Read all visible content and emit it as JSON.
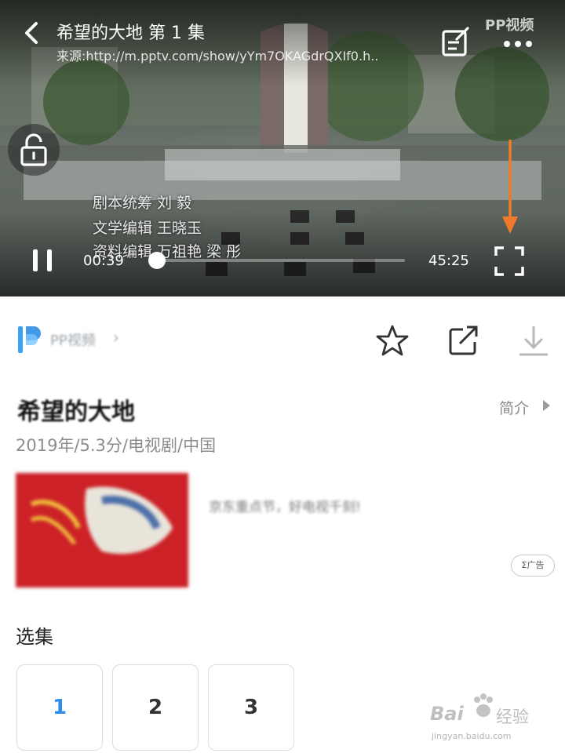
{
  "player": {
    "title": "希望的大地  第 1 集",
    "source": "来源:http://m.pptv.com/show/yYm7OKAGdrQXIf0.h..",
    "watermark": "PP视频",
    "current_time": "00:39",
    "total_time": "45:25",
    "progress": 0.014,
    "subtitle_lines": [
      "剧本统筹  刘  毅",
      "文学编辑  王晓玉",
      "资料编辑  万祖艳  梁  彤"
    ],
    "arrow_color": "#f07a2a"
  },
  "brand": {
    "name": "PP视频"
  },
  "show": {
    "title": "希望的大地",
    "intro_label": "简介",
    "meta": "2019年/5.3分/电视剧/中国"
  },
  "ad": {
    "text": "京东重点节，好电视千刻!",
    "badge": "Σ广告"
  },
  "episodes": {
    "title": "选集",
    "items": [
      {
        "label": "1",
        "active": true
      },
      {
        "label": "2",
        "active": false
      },
      {
        "label": "3",
        "active": false
      }
    ]
  },
  "watermark_overlay": {
    "brand": "Bai",
    "cn": "经验",
    "url": "jingyan.baidu.com"
  },
  "colors": {
    "accent": "#2f8ee6",
    "orange": "#f07a2a"
  }
}
